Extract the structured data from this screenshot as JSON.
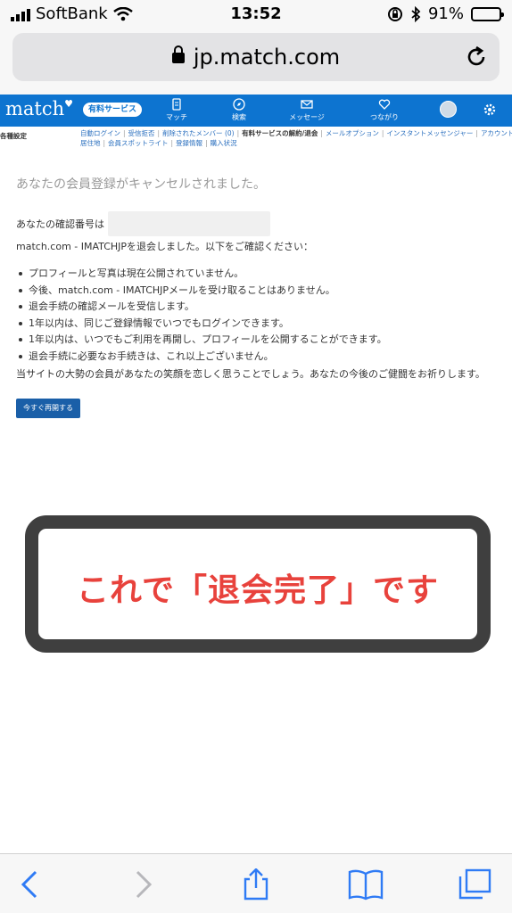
{
  "status_bar": {
    "carrier": "SoftBank",
    "time": "13:52",
    "battery": "91%",
    "battery_level": 0.91
  },
  "browser": {
    "url": "jp.match.com"
  },
  "nav": {
    "logo": "match",
    "premium_label": "有料サービス",
    "items": [
      {
        "label": "マッチ",
        "icon": "document-icon"
      },
      {
        "label": "検索",
        "icon": "compass-icon"
      },
      {
        "label": "メッセージ",
        "icon": "mail-icon"
      },
      {
        "label": "つながり",
        "icon": "heart-icon"
      }
    ]
  },
  "submenu": {
    "heading": "各種設定",
    "row1": [
      "自動ログイン",
      "受信拒否",
      "削除されたメンバー (0)",
      "有料サービスの解約/退会",
      "メールオプション",
      "インスタントメッセンジャー",
      "アカウントの連携"
    ],
    "row1_current_index": 3,
    "row2": [
      "居住地",
      "会員スポットライト",
      "登録情報",
      "購入状況"
    ]
  },
  "main": {
    "title": "あなたの会員登録がキャンセルされました。",
    "confirmation_label": "あなたの確認番号は",
    "intro": "match.com - IMATCHJPを退会しました。以下をご確認ください：",
    "bullets": [
      "プロフィールと写真は現在公開されていません。",
      "今後、match.com - IMATCHJPメールを受け取ることはありません。",
      "退会手続の確認メールを受信します。",
      "1年以内は、同じご登録情報でいつでもログインできます。",
      "1年以内は、いつでもご利用を再開し、プロフィールを公開することができます。",
      "退会手続に必要なお手続きは、これ以上ございません。"
    ],
    "closing": "当サイトの大勢の会員があなたの笑顔を恋しく思うことでしょう。あなたの今後のご健闘をお祈りします。",
    "resume_button": "今すぐ再開する"
  },
  "annotation": {
    "text": "これで「退会完了」です",
    "color": "#e8423c"
  },
  "colors": {
    "brand_blue": "#0d74d0",
    "link_blue": "#2a6fbf",
    "ios_blue": "#2f7bf5"
  }
}
